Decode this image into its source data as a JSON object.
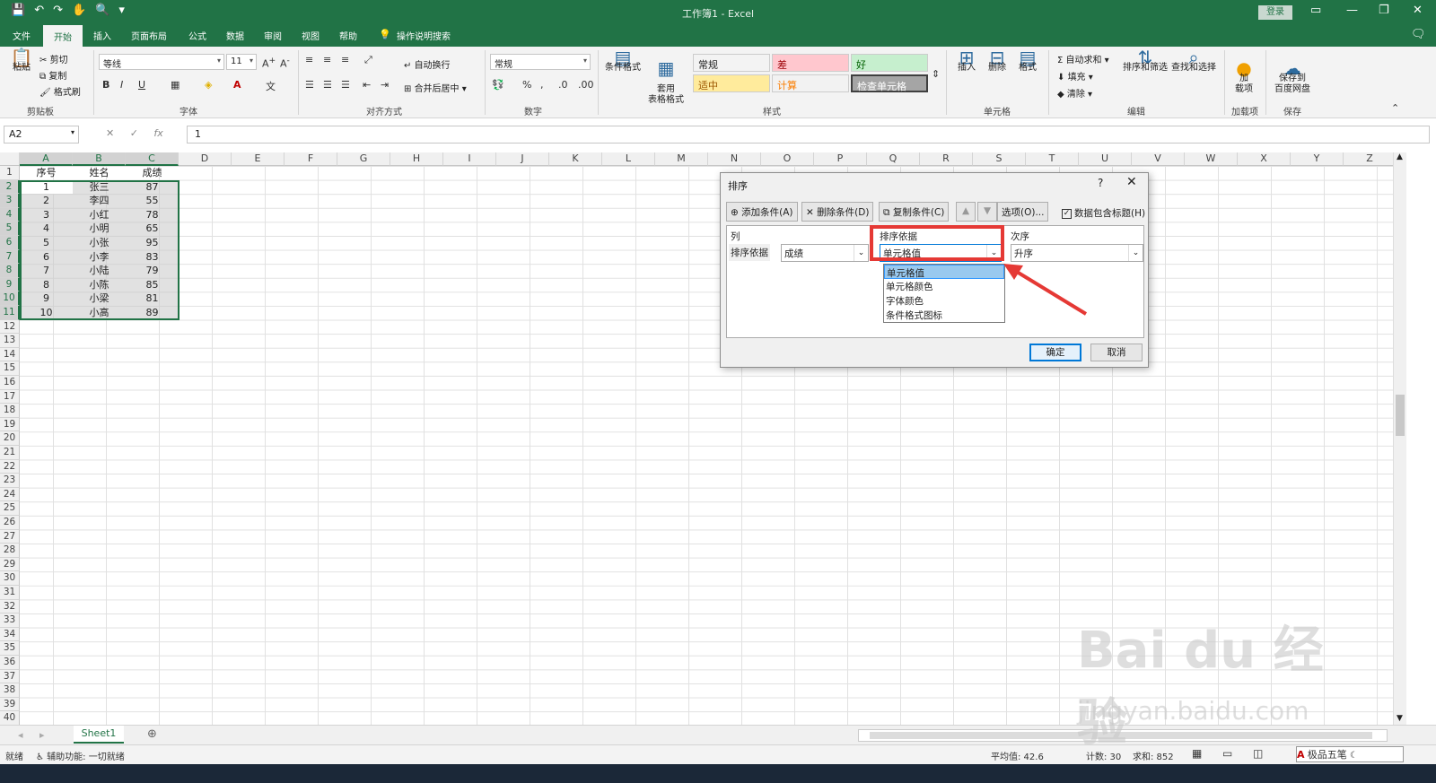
{
  "title_bar": {
    "title": "工作簿1  -  Excel",
    "login": "登录",
    "qat_icons": [
      "save-icon",
      "undo-icon",
      "redo-icon",
      "touch-mode-icon",
      "print-preview-icon",
      "customize-icon"
    ],
    "window_controls": [
      "ribbon-display-icon",
      "minimize-icon",
      "restore-icon",
      "close-icon"
    ]
  },
  "tabs": [
    {
      "label": "文件"
    },
    {
      "label": "开始",
      "active": true
    },
    {
      "label": "插入"
    },
    {
      "label": "页面布局"
    },
    {
      "label": "公式"
    },
    {
      "label": "数据"
    },
    {
      "label": "审阅"
    },
    {
      "label": "视图"
    },
    {
      "label": "帮助"
    },
    {
      "label": "操作说明搜索"
    }
  ],
  "ribbon": {
    "clipboard": {
      "paste": "粘贴",
      "cut": "剪切",
      "copy": "复制",
      "format_painter": "格式刷",
      "group": "剪贴板"
    },
    "font": {
      "name": "等线",
      "size": "11",
      "group": "字体"
    },
    "alignment": {
      "wrap": "自动换行",
      "merge": "合并后居中",
      "group": "对齐方式"
    },
    "number": {
      "format": "常规",
      "group": "数字"
    },
    "styles": {
      "conditional": "条件格式",
      "table_format": "套用\n表格格式",
      "group": "样式",
      "cells": [
        {
          "label": "常规",
          "bg": "#ffffff",
          "fg": "#222222"
        },
        {
          "label": "差",
          "bg": "#ffc7ce",
          "fg": "#9c0006"
        },
        {
          "label": "好",
          "bg": "#c6efce",
          "fg": "#006100"
        },
        {
          "label": "适中",
          "bg": "#ffeb9c",
          "fg": "#9c5700"
        },
        {
          "label": "计算",
          "bg": "#f2f2f2",
          "fg": "#fa7d00"
        },
        {
          "label": "检查单元格",
          "bg": "#a5a5a5",
          "fg": "#ffffff"
        }
      ]
    },
    "cells_group": {
      "insert": "插入",
      "delete": "删除",
      "format": "格式",
      "group": "单元格"
    },
    "editing": {
      "autosum": "自动求和",
      "fill": "填充",
      "clear": "清除",
      "sort_filter": "排序和筛选",
      "find": "查找和选择",
      "group": "编辑"
    },
    "addins": {
      "label": "加\n载项",
      "group": "加载项"
    },
    "save": {
      "label": "保存到\n百度网盘",
      "group": "保存"
    }
  },
  "formula_bar": {
    "name_box": "A2",
    "value": "1",
    "fx": "fx"
  },
  "columns": [
    "A",
    "B",
    "C",
    "D",
    "E",
    "F",
    "G",
    "H",
    "I",
    "J",
    "K",
    "L",
    "M",
    "N",
    "O",
    "P",
    "Q",
    "R",
    "S",
    "T",
    "U",
    "V",
    "W",
    "X",
    "Y",
    "Z"
  ],
  "rows_count": 40,
  "table": {
    "headers": [
      "序号",
      "姓名",
      "成绩"
    ],
    "rows": [
      [
        "1",
        "张三",
        "87"
      ],
      [
        "2",
        "李四",
        "55"
      ],
      [
        "3",
        "小红",
        "78"
      ],
      [
        "4",
        "小明",
        "65"
      ],
      [
        "5",
        "小张",
        "95"
      ],
      [
        "6",
        "小李",
        "83"
      ],
      [
        "7",
        "小陆",
        "79"
      ],
      [
        "8",
        "小陈",
        "85"
      ],
      [
        "9",
        "小梁",
        "81"
      ],
      [
        "10",
        "小高",
        "89"
      ]
    ]
  },
  "sheet_tab": "Sheet1",
  "status": {
    "ready": "就绪",
    "accessibility": "辅助功能: 一切就绪",
    "average": "平均值: 42.6",
    "count": "计数: 30",
    "sum": "求和: 852",
    "ime": "极品五笔"
  },
  "dialog": {
    "title": "排序",
    "help": "?",
    "add": "添加条件(A)",
    "delete": "删除条件(D)",
    "copy": "复制条件(C)",
    "options": "选项(O)...",
    "has_header": "数据包含标题(H)",
    "col_header": "列",
    "sort_on_header": "排序依据",
    "order_header": "次序",
    "row_label": "排序依据",
    "column_value": "成绩",
    "sort_on_value": "单元格值",
    "order_value": "升序",
    "dropdown_options": [
      "单元格值",
      "单元格颜色",
      "字体颜色",
      "条件格式图标"
    ],
    "ok": "确定",
    "cancel": "取消"
  },
  "watermark": {
    "main": "Bai du 经验",
    "sub": "jingyan.baidu.com"
  },
  "accent_color": "#217346",
  "highlight_color": "#e53935"
}
